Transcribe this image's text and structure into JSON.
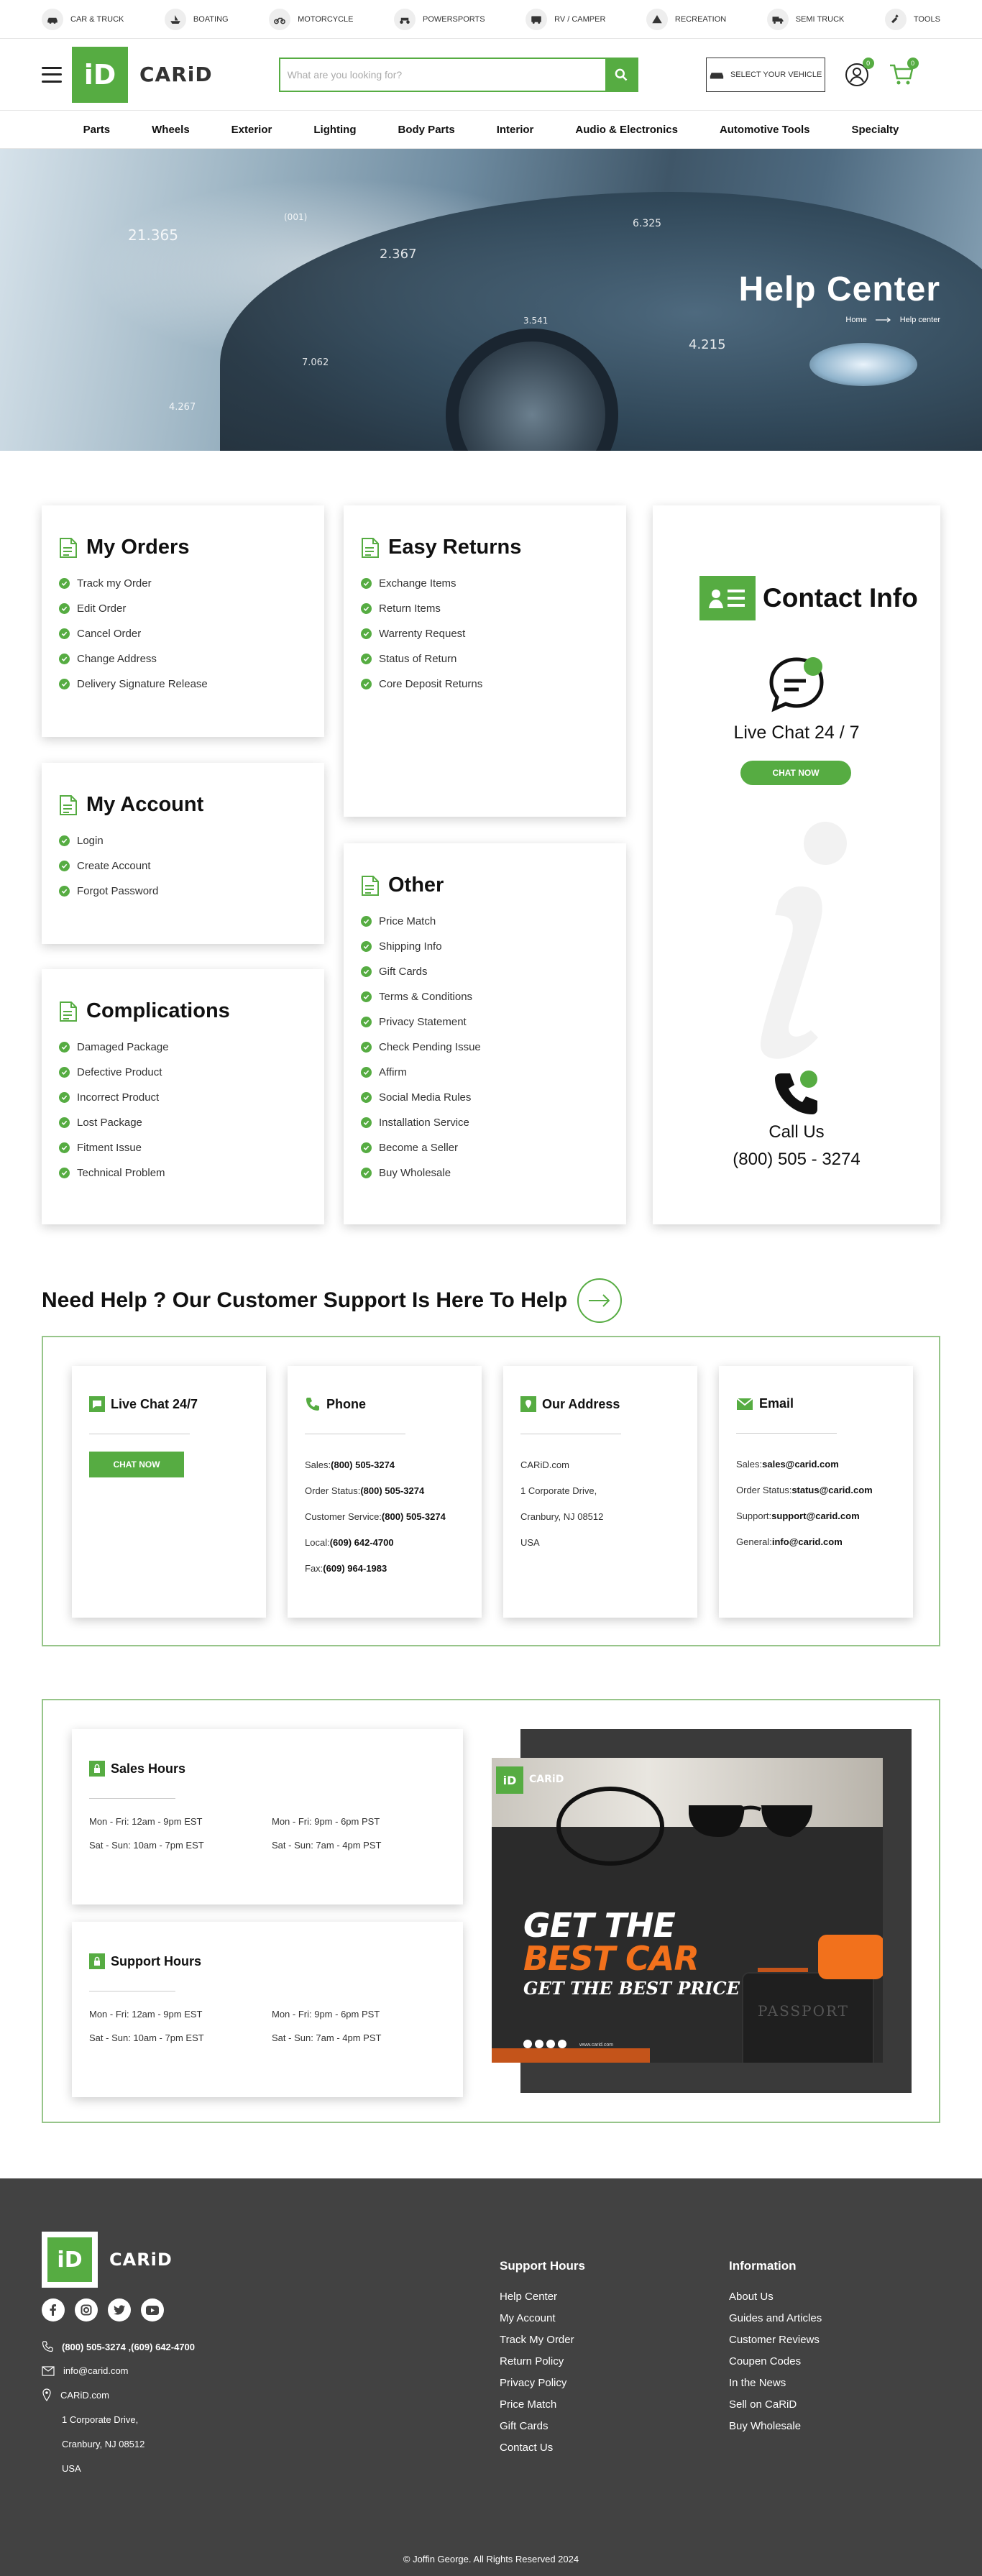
{
  "top_categories": [
    {
      "label": "CAR & TRUCK",
      "icon": "car-truck-icon"
    },
    {
      "label": "BOATING",
      "icon": "boat-icon"
    },
    {
      "label": "MOTORCYCLE",
      "icon": "motorcycle-icon"
    },
    {
      "label": "POWERSPORTS",
      "icon": "atv-icon"
    },
    {
      "label": "RV / CAMPER",
      "icon": "rv-icon"
    },
    {
      "label": "RECREATION",
      "icon": "tent-icon"
    },
    {
      "label": "SEMI TRUCK",
      "icon": "semi-truck-icon"
    },
    {
      "label": "TOOLS",
      "icon": "tools-icon"
    }
  ],
  "header": {
    "logo_text": "CARiD",
    "logo_mark": "iD",
    "search_placeholder": "What are you looking for?",
    "vehicle_button": "SELECT YOUR VEHICLE",
    "account_badge": "0",
    "cart_badge": "0"
  },
  "nav": [
    "Parts",
    "Wheels",
    "Exterior",
    "Lighting",
    "Body Parts",
    "Interior",
    "Audio & Electronics",
    "Automotive Tools",
    "Specialty"
  ],
  "hero": {
    "title": "Help Center",
    "breadcrumb_home": "Home",
    "breadcrumb_current": "Help center",
    "overlay_numbers": [
      "21.365",
      "(001)",
      "2.367",
      "6.325",
      "3.541",
      "4.215",
      "7.062",
      "4.267"
    ]
  },
  "cards": {
    "orders": {
      "title": "My Orders",
      "items": [
        "Track my Order",
        "Edit Order",
        "Cancel Order",
        "Change Address",
        "Delivery Signature Release"
      ]
    },
    "returns": {
      "title": "Easy Returns",
      "items": [
        "Exchange Items",
        "Return Items",
        "Warrenty Request",
        "Status of Return",
        "Core Deposit Returns"
      ]
    },
    "account": {
      "title": "My Account",
      "items": [
        "Login",
        "Create Account",
        "Forgot Password"
      ]
    },
    "other": {
      "title": "Other",
      "items": [
        "Price Match",
        "Shipping Info",
        "Gift Cards",
        "Terms & Conditions",
        "Privacy Statement",
        "Check Pending Issue",
        "Affirm",
        "Social Media Rules",
        "Installation Service",
        "Become a Seller",
        "Buy Wholesale"
      ]
    },
    "complications": {
      "title": "Complications",
      "items": [
        "Damaged Package",
        "Defective Product",
        "Incorrect Product",
        "Lost Package",
        "Fitment Issue",
        "Technical Problem"
      ]
    }
  },
  "contact": {
    "title": "Contact Info",
    "live_chat": "Live Chat 24 / 7",
    "chat_button": "CHAT NOW",
    "call_us": "Call Us",
    "phone": "(800) 505 - 3274"
  },
  "support": {
    "heading": "Need Help ? Our Customer Support Is Here To Help",
    "live_chat": {
      "title": "Live Chat 24/7",
      "button": "CHAT NOW"
    },
    "phone": {
      "title": "Phone",
      "lines": [
        {
          "label": "Sales:",
          "value": "(800) 505-3274"
        },
        {
          "label": "Order Status:",
          "value": "(800) 505-3274"
        },
        {
          "label": "Customer Service:",
          "value": "(800) 505-3274"
        },
        {
          "label": "Local:",
          "value": "(609) 642-4700"
        },
        {
          "label": "Fax:",
          "value": "(609) 964-1983"
        }
      ]
    },
    "address": {
      "title": "Our Address",
      "lines": [
        "CARiD.com",
        "1 Corporate Drive,",
        "Cranbury, NJ 08512",
        "USA"
      ]
    },
    "email": {
      "title": "Email",
      "lines": [
        {
          "label": "Sales:",
          "value": "sales@carid.com"
        },
        {
          "label": "Order Status:",
          "value": "status@carid.com"
        },
        {
          "label": "Support:",
          "value": "support@carid.com"
        },
        {
          "label": "General:",
          "value": "info@carid.com"
        }
      ]
    }
  },
  "hours": {
    "sales": {
      "title": "Sales Hours",
      "rows": [
        "Mon - Fri: 12am - 9pm EST",
        "Mon - Fri: 9pm - 6pm PST",
        "Sat - Sun: 10am - 7pm EST",
        "Sat - Sun: 7am - 4pm PST"
      ]
    },
    "support": {
      "title": "Support Hours",
      "rows": [
        "Mon - Fri: 12am - 9pm EST",
        "Mon - Fri: 9pm - 6pm PST",
        "Sat - Sun: 10am - 7pm EST",
        "Sat - Sun: 7am - 4pm PST"
      ]
    }
  },
  "promo": {
    "logo_mark": "iD",
    "logo_text": "CARiD",
    "line1": "GET THE",
    "line2": "BEST CAR",
    "line3": "GET THE BEST PRICE",
    "url": "www.carid.com",
    "passport": "PASSPORT"
  },
  "footer": {
    "logo_mark": "iD",
    "logo_text": "CARiD",
    "socials": [
      "f",
      "ig",
      "tw",
      "yt"
    ],
    "phone": "(800) 505-3274 ,(609) 642-4700",
    "email": "info@carid.com",
    "site": "CARiD.com",
    "address": [
      "1 Corporate Drive,",
      "Cranbury, NJ 08512",
      "USA"
    ],
    "col1": {
      "title": "Support Hours",
      "links": [
        "Help Center",
        "My Account",
        "Track My Order",
        "Return Policy",
        "Privacy Policy",
        "Price Match",
        "Gift Cards",
        "Contact Us"
      ]
    },
    "col2": {
      "title": "Information",
      "links": [
        "About Us",
        "Guides and Articles",
        "Customer Reviews",
        "Coupen Codes",
        "In the News",
        "Sell on CaRiD",
        "Buy Wholesale"
      ]
    },
    "copyright": "© Joffin George. All Rights Reserved 2024"
  },
  "colors": {
    "accent": "#56ac42",
    "footer_bg": "#424242",
    "border": "#97c58a"
  }
}
